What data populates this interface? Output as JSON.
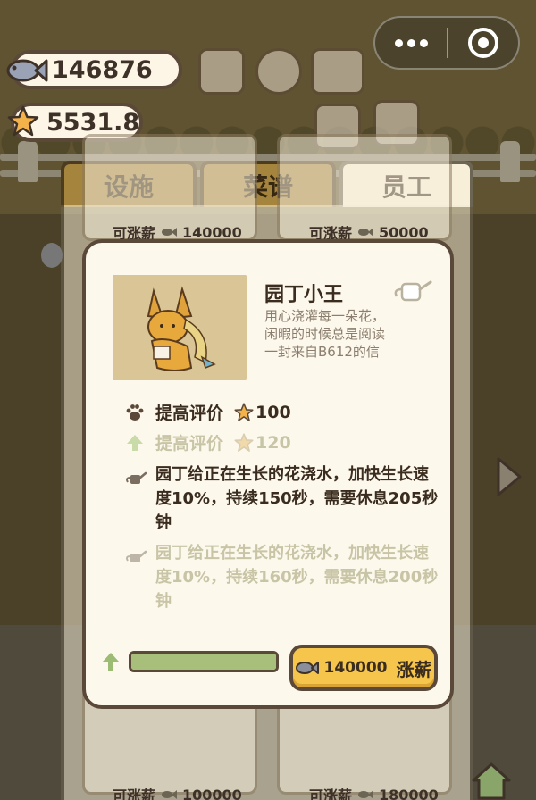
{
  "currency": {
    "fish": "146876",
    "stars": "5531.8"
  },
  "tabs": [
    {
      "label": "设施",
      "active": false
    },
    {
      "label": "菜谱",
      "active": false
    },
    {
      "label": "员工",
      "active": true
    }
  ],
  "staff_cards": {
    "raise_label": "可涨薪",
    "cards": [
      {
        "cost": "140000"
      },
      {
        "cost": "50000"
      },
      {
        "cost": "100000"
      },
      {
        "cost": "180000"
      }
    ]
  },
  "modal": {
    "name": "园丁小王",
    "description": "用心浇灌每一朵花，闲暇的时候总是阅读一封来自B612的信",
    "current_stat": {
      "label": "提高评价",
      "value": "100"
    },
    "next_stat": {
      "label": "提高评价",
      "value": "120"
    },
    "current_skill": "园丁给正在生长的花浇水，加快生长速度10%，持续150秒，需要休息205秒钟",
    "next_skill": "园丁给正在生长的花浇水，加快生长速度10%，持续160秒，需要休息200秒钟",
    "upgrade_progress": 1.0,
    "raise_button": {
      "cost": "140000",
      "label": "涨薪"
    }
  },
  "colors": {
    "accent_yellow": "#f6c54c",
    "border_brown": "#5a4838",
    "progress_green": "#a8bf7b",
    "muted_text": "#c7c5a6"
  },
  "icons": [
    "fish-icon",
    "star-icon",
    "ranking-icon",
    "gear-icon",
    "book-icon",
    "camera-icon",
    "news-icon",
    "watering-can-icon",
    "paw-icon",
    "arrow-up-icon",
    "more-icon",
    "close-target-icon"
  ]
}
